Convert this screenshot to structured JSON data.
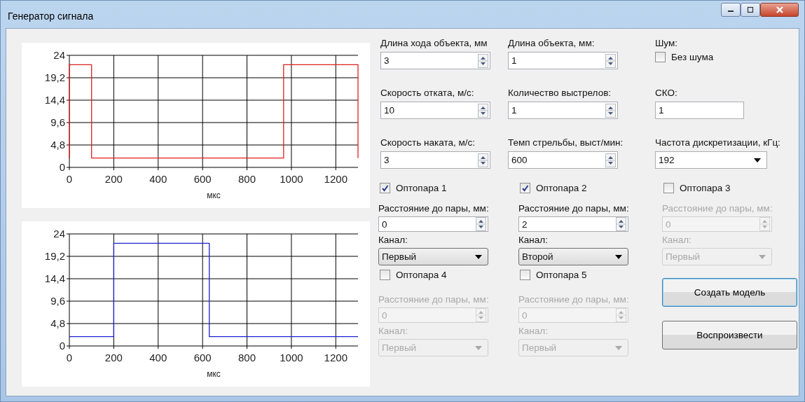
{
  "window": {
    "title": "Генератор сигнала"
  },
  "charts": [
    {
      "chart_data": {
        "type": "line",
        "xlabel": "мкс",
        "xlim": [
          0,
          1300
        ],
        "ylim": [
          0,
          24
        ],
        "xticks": [
          0,
          200,
          400,
          600,
          800,
          1000,
          1200
        ],
        "yticks": [
          {
            "value": 0,
            "label": "0"
          },
          {
            "value": 4.8,
            "label": "4,8"
          },
          {
            "value": 9.6,
            "label": "9,6"
          },
          {
            "value": 14.4,
            "label": "14,4"
          },
          {
            "value": 19.2,
            "label": "19,2"
          },
          {
            "value": 24,
            "label": "24"
          }
        ],
        "grid": true,
        "series": [
          {
            "color": "#e02020",
            "x": [
              0,
              0,
              100,
              100,
              965,
              965,
              1300,
              1300
            ],
            "values": [
              2,
              22,
              22,
              2,
              2,
              22,
              22,
              2
            ]
          }
        ]
      }
    },
    {
      "chart_data": {
        "type": "line",
        "xlabel": "мкс",
        "xlim": [
          0,
          1300
        ],
        "ylim": [
          0,
          24
        ],
        "xticks": [
          0,
          200,
          400,
          600,
          800,
          1000,
          1200
        ],
        "yticks": [
          {
            "value": 0,
            "label": "0"
          },
          {
            "value": 4.8,
            "label": "4,8"
          },
          {
            "value": 9.6,
            "label": "9,6"
          },
          {
            "value": 14.4,
            "label": "14,4"
          },
          {
            "value": 19.2,
            "label": "19,2"
          },
          {
            "value": 24,
            "label": "24"
          }
        ],
        "grid": true,
        "series": [
          {
            "color": "#2020d0",
            "x": [
              0,
              200,
              200,
              630,
              630,
              1300
            ],
            "values": [
              2,
              2,
              22,
              22,
              2,
              2
            ]
          }
        ]
      }
    }
  ],
  "params": [
    {
      "kind": "spin",
      "label": "Длина хода объекта, мм",
      "value": "3"
    },
    {
      "kind": "spin",
      "label": "Длина объекта, мм:",
      "value": "1"
    },
    {
      "kind": "checkbox",
      "label": "Шум:",
      "option": "Без шума",
      "checked": false
    },
    {
      "kind": "spin",
      "label": "Скорость отката, м/с:",
      "value": "10"
    },
    {
      "kind": "spin",
      "label": "Количество выстрелов:",
      "value": "1"
    },
    {
      "kind": "text",
      "label": "СКО:",
      "value": "1"
    },
    {
      "kind": "spin",
      "label": "Скорость наката, м/с:",
      "value": "3"
    },
    {
      "kind": "spin",
      "label": "Темп стрельбы, выст/мин:",
      "value": "600"
    },
    {
      "kind": "dropdown",
      "label": "Частота дискретизации, кГц:",
      "value": "192"
    }
  ],
  "optopairs": [
    {
      "label": "Оптопара 1",
      "checked": true,
      "distance_label": "Расстояние до пары, мм:",
      "distance": "0",
      "channel_label": "Канал:",
      "channel": "Первый"
    },
    {
      "label": "Оптопара 2",
      "checked": true,
      "distance_label": "Расстояние до пары, мм:",
      "distance": "2",
      "channel_label": "Канал:",
      "channel": "Второй"
    },
    {
      "label": "Оптопара 3",
      "checked": false,
      "distance_label": "Расстояние до пары, мм:",
      "distance": "0",
      "channel_label": "Канал:",
      "channel": "Первый"
    },
    {
      "label": "Оптопара 4",
      "checked": false,
      "distance_label": "Расстояние до пары, мм:",
      "distance": "0",
      "channel_label": "Канал:",
      "channel": "Первый"
    },
    {
      "label": "Оптопара 5",
      "checked": false,
      "distance_label": "Расстояние до пары, мм:",
      "distance": "0",
      "channel_label": "Канал:",
      "channel": "Первый"
    }
  ],
  "buttons": [
    {
      "label": "Создать модель",
      "focused": true
    },
    {
      "label": "Воспроизвести",
      "focused": false
    }
  ]
}
